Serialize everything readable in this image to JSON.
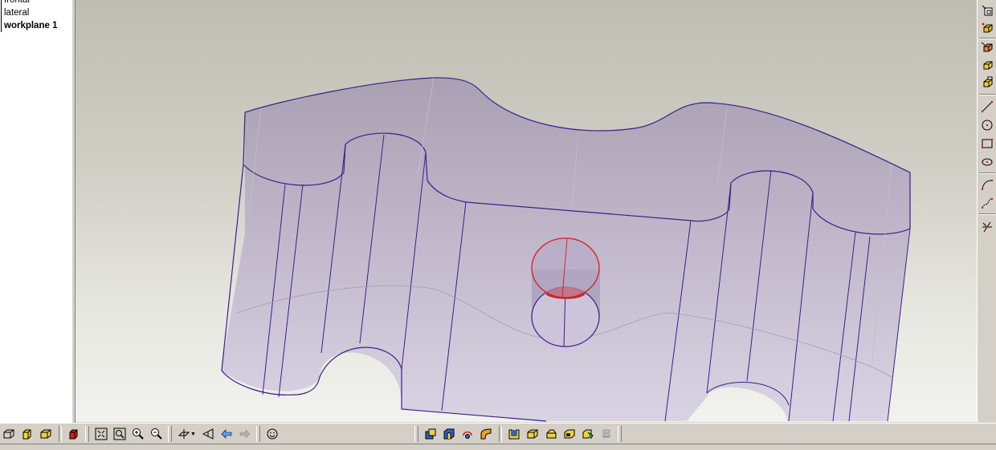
{
  "tree": {
    "items": [
      {
        "label": "frontal",
        "active": false
      },
      {
        "label": "lateral",
        "active": false
      },
      {
        "label": "workplane 1",
        "active": true
      }
    ]
  },
  "colors": {
    "edge": "#3a1f8a",
    "face": "#b9aecb",
    "highlight": "#e01818",
    "viewport_top": "#bdbdb2",
    "viewport_bottom": "#f2f2ee"
  },
  "right_toolbar": {
    "icons": [
      "workplane-icon",
      "extrude-icon",
      "revolve-icon",
      "sweep-icon",
      "loft-icon",
      "line-icon",
      "circle-icon",
      "rectangle-icon",
      "ellipse-icon",
      "arc-icon",
      "spline-icon",
      "trim-icon"
    ]
  },
  "bottom_toolbar": {
    "view_icons": [
      "wireframe-icon",
      "shaded-icon",
      "shaded-edges-icon",
      "hidden-line-icon"
    ],
    "zoom_icons": [
      "zoom-extents-icon",
      "zoom-window-icon",
      "zoom-in-icon",
      "zoom-out-icon"
    ],
    "nav_icons": [
      "view-orient-icon",
      "previous-view-icon",
      "back-arrow-icon",
      "forward-arrow-icon"
    ],
    "misc_icons": [
      "smiley-icon"
    ],
    "feature_icons": [
      "boolean-icon",
      "pocket-icon",
      "rotate-icon",
      "fillet-icon",
      "shell-icon",
      "chamfer-icon",
      "draft-icon",
      "offset-icon",
      "split-icon",
      "pattern-icon"
    ]
  }
}
